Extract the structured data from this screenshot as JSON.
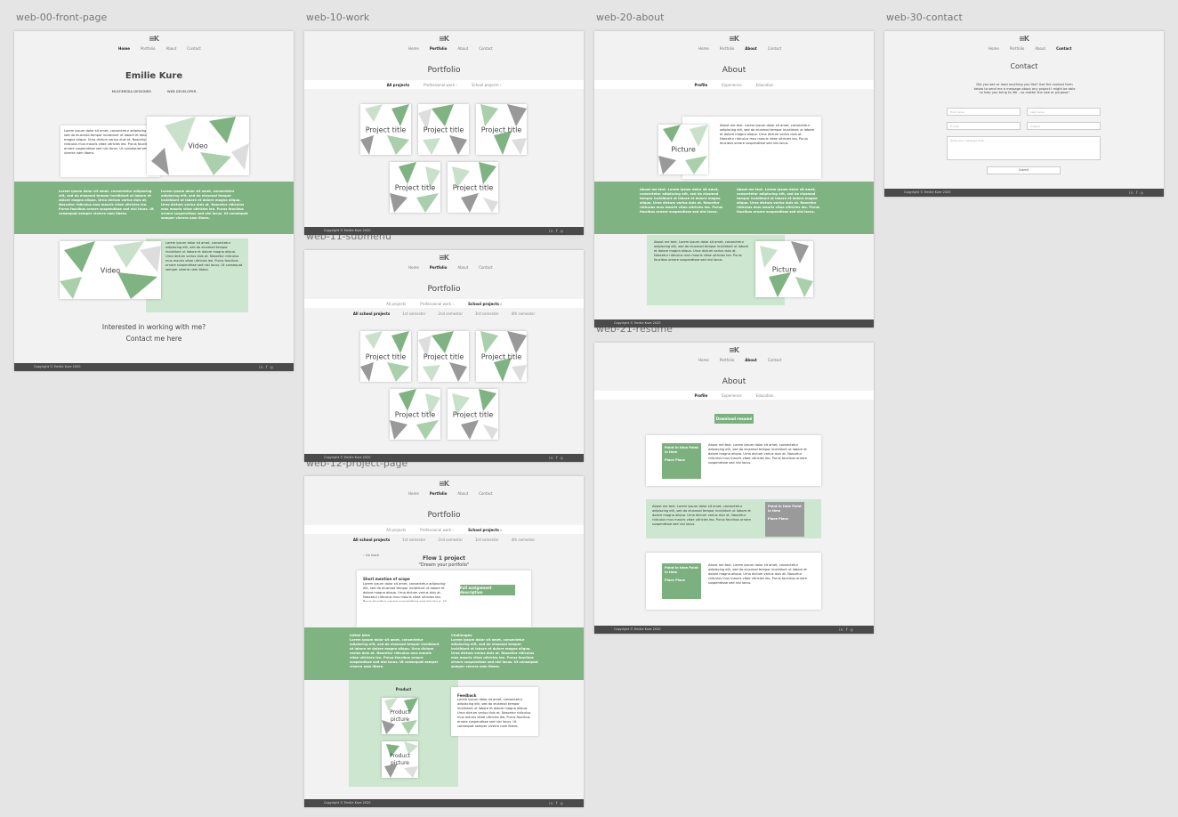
{
  "artboards": {
    "a0": "web-00-front-page",
    "a10": "web-10-work",
    "a11": "web-11-submenu",
    "a12": "web-12-project-page",
    "a20": "web-20-about",
    "a21": "web-21-resume",
    "a30": "web-30-contact"
  },
  "logo": "≡K",
  "nav": {
    "home": "Home",
    "portfolio": "Portfolio",
    "about": "About",
    "contact": "Contact"
  },
  "front": {
    "name": "Emilie Kure",
    "role1": "MULTIMEDIA DESIGNER",
    "role2": "WEB DEVELOPER",
    "video": "Video",
    "cta1": "Interested in working with me?",
    "cta2": "Contact me here"
  },
  "portfolio": {
    "title": "Portfolio",
    "tabs": [
      "All projects",
      "Professional work  ›",
      "School projects  ›"
    ],
    "sub": [
      "All school projects",
      "1st semester",
      "2nd semester",
      "3rd semester",
      "4th semester"
    ],
    "project": "Project title"
  },
  "project": {
    "back": "‹  Go back",
    "title": "Flow 1 project",
    "subtitle": "\"Dream your portfolio\"",
    "scope": "Short mention of scope",
    "btn": "Full assignment description",
    "initial": "Initial idea",
    "challenges": "Challenges",
    "product": "Product",
    "productpic": "Product picture",
    "feedback": "Feedback"
  },
  "about": {
    "title": "About",
    "tabs": [
      "Profile",
      "Experience",
      "Education"
    ],
    "picture": "Picture",
    "download": "Download resumé",
    "pointtitle": "Point in time Point in time",
    "place": "Place Place"
  },
  "contact": {
    "title": "Contact",
    "intro": "Did you see or read anything you like? Use the contact form below to send me a message about any project I might be able to help you bring to life - no matter the size or purpose!",
    "firstname": "First name",
    "lastname": "Last name",
    "email": "E-mail",
    "subject": "Subject",
    "message": "Write your message here",
    "submit": "Submit"
  },
  "footer": {
    "copyright": "Copyright © Emilie Kure 2020",
    "social": "in f ◎"
  },
  "lorem": "Lorem ipsum dolor sit amet, consectetur adipiscing elit, sed do eiusmod tempor incididunt ut labore et dolore magna aliqua. Urna dictum varius duis at. Nascetur ridiculus mus mauris vitae ultricies leo. Purus faucibus ornare suspendisse sed nisi lacus. Ut consequat semper viverra nam libero.",
  "lorem_about": "About me text. Lorem ipsum dolor sit amet, consectetur adipiscing elit, sed do eiusmod tempor incididunt ut labore et dolore magna aliqua. Urna dictum varius duis at. Nascetur ridiculus mus mauris vitae ultricies leo. Purus faucibus ornare suspendisse sed nisi lacus.",
  "colors": {
    "accent": "#80b382",
    "light": "#cde6cf",
    "footer": "#4a4a4a"
  }
}
